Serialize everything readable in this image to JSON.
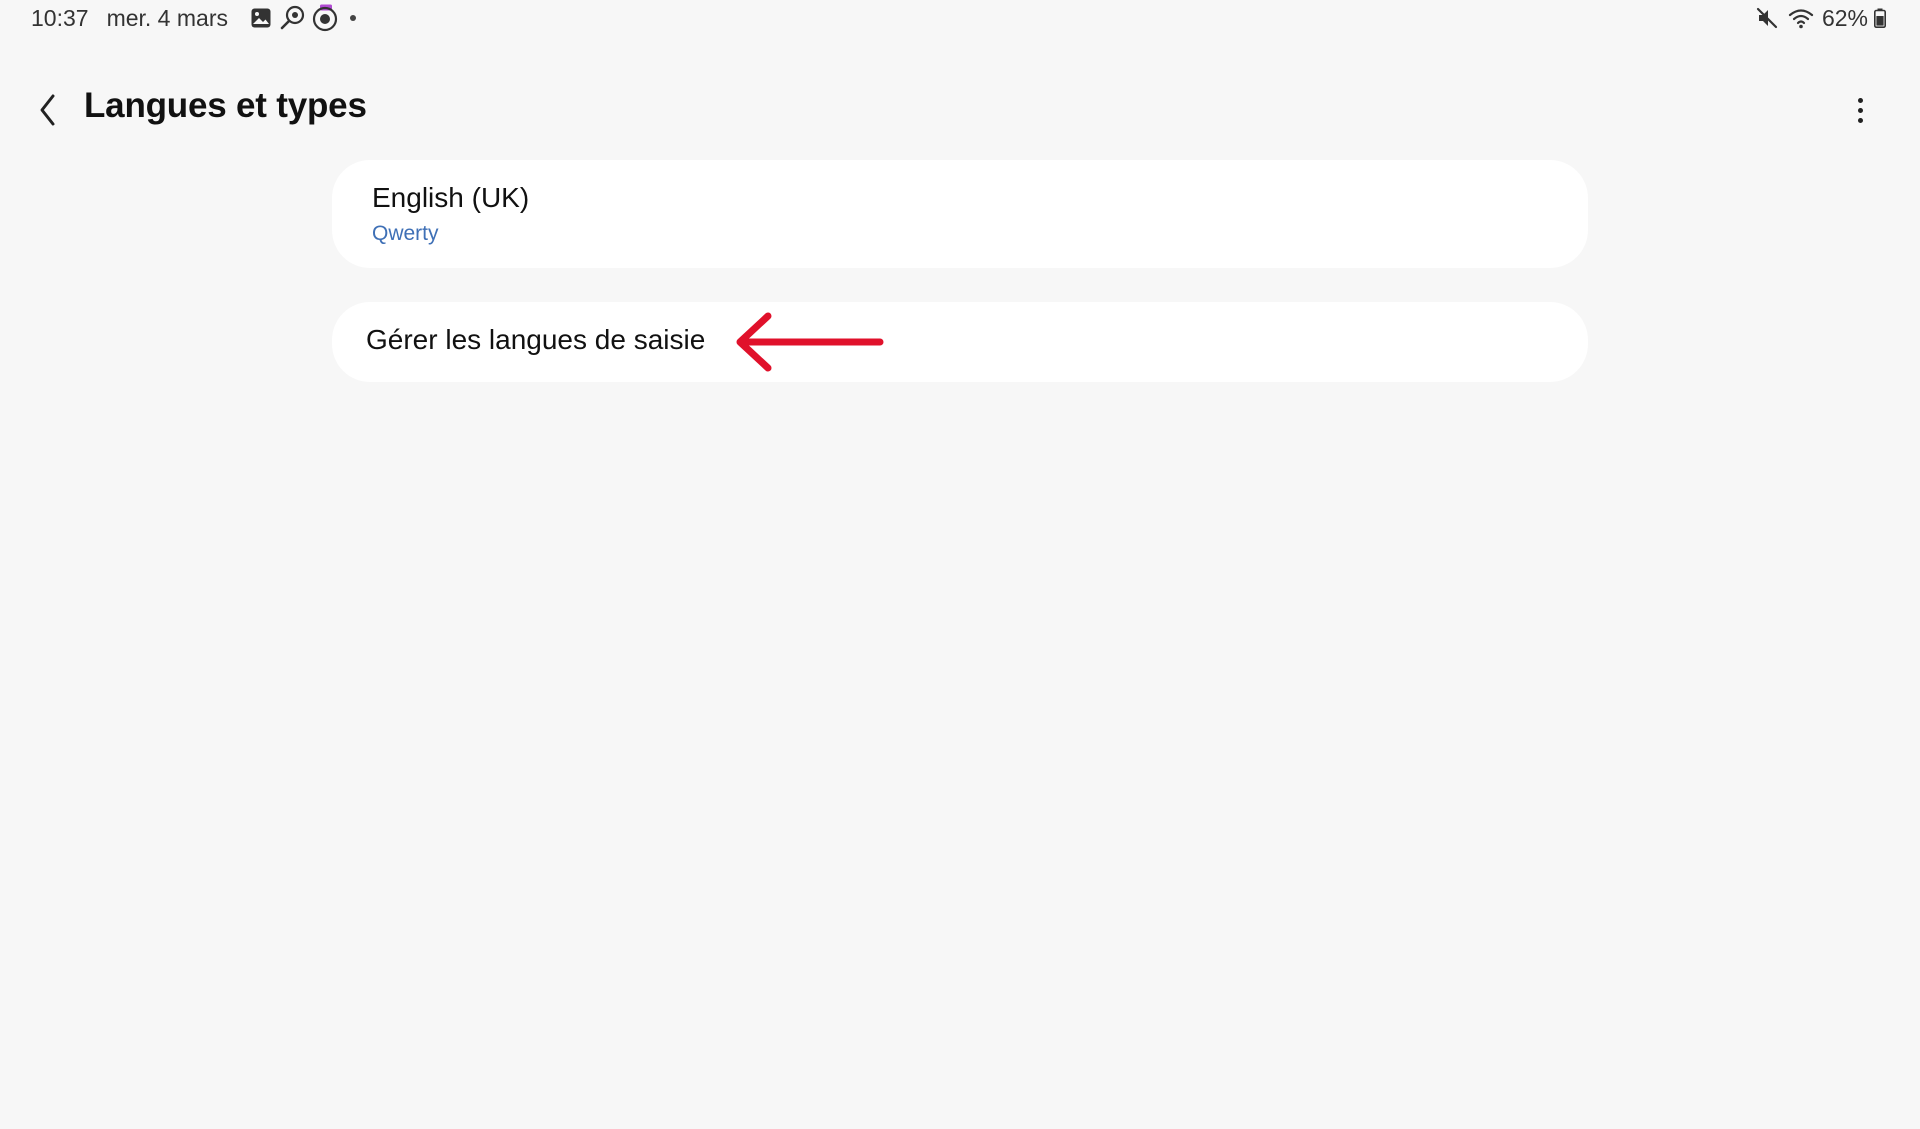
{
  "status_bar": {
    "time": "10:37",
    "date": "mer. 4 mars",
    "left_icons": [
      "gallery-icon",
      "search-location-icon",
      "camera-app-icon"
    ],
    "right_icons": [
      "mute-icon",
      "wifi-icon",
      "battery-icon"
    ],
    "battery": "62%"
  },
  "header": {
    "title": "Langues et types",
    "back_icon": "chevron-left-icon",
    "menu_icon": "more-vertical-icon"
  },
  "languages": [
    {
      "name": "English (UK)",
      "layout": "Qwerty"
    }
  ],
  "manage": {
    "label": "Gérer les langues de saisie"
  },
  "annotation": {
    "icon": "arrow-left-icon",
    "color": "#e0112b"
  },
  "colors": {
    "background": "#f7f7f7",
    "card": "#ffffff",
    "link": "#3f70b6"
  }
}
